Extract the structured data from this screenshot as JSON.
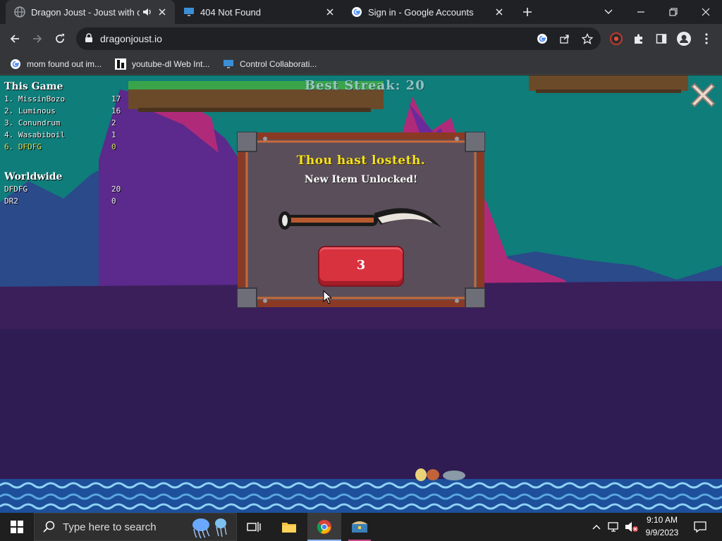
{
  "browser": {
    "tabs": [
      {
        "title": "Dragon Joust - Joust with dr",
        "active": true,
        "audio": true
      },
      {
        "title": "404 Not Found",
        "active": false
      },
      {
        "title": "Sign in - Google Accounts",
        "active": false
      }
    ],
    "url": "dragonjoust.io",
    "bookmarks": [
      {
        "label": "mom found out im..."
      },
      {
        "label": "youtube-dl Web Int..."
      },
      {
        "label": "Control Collaborati..."
      }
    ],
    "colors": {
      "frame": "#202124",
      "toolbar": "#35363a",
      "text": "#e8eaed"
    }
  },
  "game": {
    "best_streak": "Best Streak: 20",
    "this_game": {
      "title": "This Game",
      "rows": [
        {
          "name": "1. MissinBozo",
          "score": "17"
        },
        {
          "name": "2. Luminous",
          "score": "16"
        },
        {
          "name": "3. Conundrum",
          "score": "2"
        },
        {
          "name": "4. Wasabiboil",
          "score": "1"
        },
        {
          "name": "6. DFDFG",
          "score": "0",
          "highlight": true
        }
      ]
    },
    "worldwide": {
      "title": "Worldwide",
      "rows": [
        {
          "name": "DFDFG",
          "score": "20"
        },
        {
          "name": "DR2",
          "score": "0"
        }
      ]
    },
    "modal": {
      "title": "Thou hast losteth.",
      "subtitle": "New Item Unlocked!",
      "item_icon": "curved-blade-icon",
      "button_label": "3"
    },
    "colors": {
      "modal_title": "#f4e21f",
      "button": "#d8323f",
      "highlight_row": "#d7e05a"
    }
  },
  "taskbar": {
    "search_placeholder": "Type here to search",
    "time": "9:10 AM",
    "date": "9/9/2023"
  }
}
